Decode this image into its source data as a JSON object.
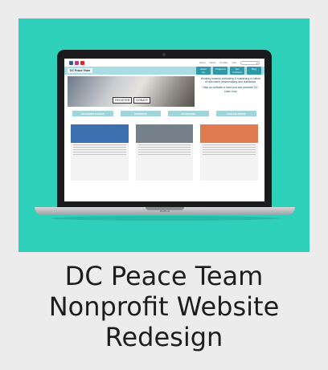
{
  "site": {
    "top_links": [
      "About",
      "News",
      "Contact",
      "Join"
    ],
    "search_icon": "search-icon",
    "social_icons": [
      {
        "name": "facebook-icon",
        "color": "#3b5998"
      },
      {
        "name": "instagram-icon",
        "color": "#c1358d"
      },
      {
        "name": "youtube-icon",
        "color": "#d62828"
      }
    ],
    "logo": "DC Peace Team",
    "nav": [
      "About Us",
      "Programs",
      "Get Involved",
      "Blog"
    ],
    "hero": {
      "register": "REGISTER",
      "donate": "DONATE",
      "tagline_1": "Working towards cultivating & sustaining a culture of nonviolent peacemaking and resistance.",
      "tagline_2": "Help us cultivate a more just and peaceful DC. Learn how."
    },
    "quick_links": [
      "UPCOMING EVENTS",
      "TRAININGS",
      "PROGRAMS",
      "HOW WE SERVE"
    ],
    "card_heads": [
      "Peace Building",
      "",
      "Interactions"
    ],
    "card_colors": [
      "#3c6fb0",
      "#76808a",
      "#e07a4f"
    ]
  },
  "laptop": {
    "brand": "MacBook"
  },
  "caption": {
    "line1": "DC Peace Team",
    "line2": "Nonprofit Website",
    "line3": "Redesign"
  },
  "colors": {
    "card_bg": "#2ed0b9",
    "accent": "#2e9aa9"
  }
}
